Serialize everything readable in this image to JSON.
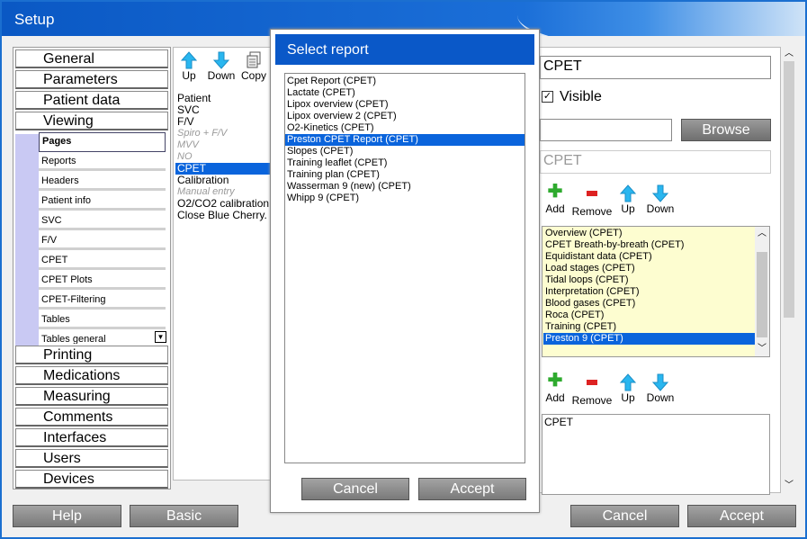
{
  "window": {
    "title": "Setup"
  },
  "categories_top": [
    "General",
    "Parameters",
    "Patient data",
    "Viewing"
  ],
  "subitems": [
    "Pages",
    "Reports",
    "Headers",
    "Patient info",
    "SVC",
    "F/V",
    "CPET",
    "CPET Plots",
    "CPET-Filtering",
    "Tables",
    "Tables general"
  ],
  "categories_bottom": [
    "Printing",
    "Medications",
    "Measuring",
    "Comments",
    "Interfaces",
    "Users",
    "Devices"
  ],
  "page_tools": {
    "up": "Up",
    "down": "Down",
    "copy": "Copy"
  },
  "pages": [
    {
      "label": "Patient",
      "style": ""
    },
    {
      "label": "SVC",
      "style": ""
    },
    {
      "label": "F/V",
      "style": ""
    },
    {
      "label": "Spiro + F/V",
      "style": "it"
    },
    {
      "label": "MVV",
      "style": "it"
    },
    {
      "label": "NO",
      "style": "it"
    },
    {
      "label": "CPET",
      "style": "sel"
    },
    {
      "label": "Calibration",
      "style": ""
    },
    {
      "label": "Manual entry",
      "style": "it"
    },
    {
      "label": "O2/CO2 calibration",
      "style": ""
    },
    {
      "label": "Close Blue Cherry.",
      "style": ""
    }
  ],
  "dialog": {
    "title": "Select report",
    "reports": [
      "Cpet Report (CPET)",
      "Lactate (CPET)",
      "Lipox overview (CPET)",
      "Lipox overview 2 (CPET)",
      "O2-Kinetics (CPET)",
      "Preston CPET Report (CPET)",
      "Slopes (CPET)",
      "Training leaflet (CPET)",
      "Training plan (CPET)",
      "Wasserman 9 (new) (CPET)",
      "Whipp 9 (CPET)"
    ],
    "selected_index": 5,
    "cancel": "Cancel",
    "accept": "Accept"
  },
  "right": {
    "name_value": "CPET",
    "visible_label": "Visible",
    "visible_checked": true,
    "browse": "Browse",
    "page_name": "CPET",
    "tools": {
      "add": "Add",
      "remove": "Remove",
      "up": "Up",
      "down": "Down"
    },
    "tabs": [
      "Overview (CPET)",
      "CPET Breath-by-breath (CPET)",
      "Equidistant data (CPET)",
      "Load stages (CPET)",
      "Tidal loops (CPET)",
      "Interpretation (CPET)",
      "Blood gases (CPET)",
      "Roca (CPET)",
      "Training (CPET)",
      "Preston 9 (CPET)"
    ],
    "selected_tab": 9,
    "bottom_list": [
      "CPET"
    ]
  },
  "footer": {
    "help": "Help",
    "basic": "Basic",
    "cancel": "Cancel",
    "accept": "Accept"
  },
  "colors": {
    "title_bar": "#0a58c4",
    "selection": "#0a64dc",
    "lavender": "#c9c9f3",
    "yellow_list": "#fdfdd0"
  }
}
